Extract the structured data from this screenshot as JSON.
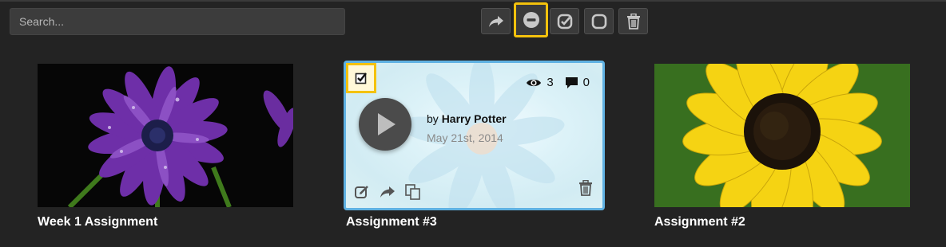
{
  "search": {
    "placeholder": "Search..."
  },
  "toolbar": {
    "buttons": [
      {
        "icon": "share-icon"
      },
      {
        "icon": "minus-circle-icon",
        "highlighted": true
      },
      {
        "icon": "check-square-icon"
      },
      {
        "icon": "square-icon"
      },
      {
        "icon": "trash-icon"
      }
    ]
  },
  "cards": [
    {
      "title": "Week 1 Assignment",
      "thumbnail": "purple-daisy"
    },
    {
      "title": "Assignment #3",
      "selected": true,
      "views": "3",
      "comments": "0",
      "by_prefix": "by",
      "author": "Harry Potter",
      "date": "May 21st, 2014"
    },
    {
      "title": "Assignment #2",
      "thumbnail": "sunflower"
    }
  ],
  "colors": {
    "background": "#232323",
    "highlight": "#f4c20d",
    "selected_border": "#5fb1e2"
  }
}
